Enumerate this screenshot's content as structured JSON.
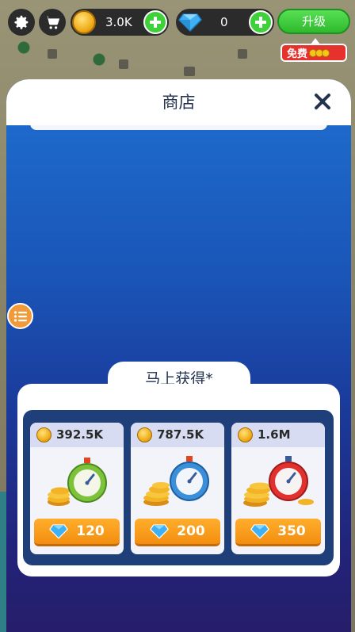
{
  "hud": {
    "settings_icon": "gear-icon",
    "cart_icon": "cart-icon",
    "coins": "3.0K",
    "gems": "0",
    "upgrade_label": "升级",
    "free_label": "免费"
  },
  "shop": {
    "title": "商店",
    "close_icon": "close-icon",
    "menu_icon": "list-icon",
    "section_title": "马上获得*",
    "items": [
      {
        "coin_amount": "392.5K",
        "gem_price": "120",
        "art": "green-stopwatch-coins"
      },
      {
        "coin_amount": "787.5K",
        "gem_price": "200",
        "art": "blue-stopwatch-coins"
      },
      {
        "coin_amount": "1.6M",
        "gem_price": "350",
        "art": "red-stopwatch-coins"
      }
    ]
  },
  "colors": {
    "accent_green": "#3ed13a",
    "accent_orange": "#f38d10",
    "panel_blue": "#1e6fd0",
    "panel_purple": "#261e6a",
    "badge_red": "#e5322c"
  }
}
